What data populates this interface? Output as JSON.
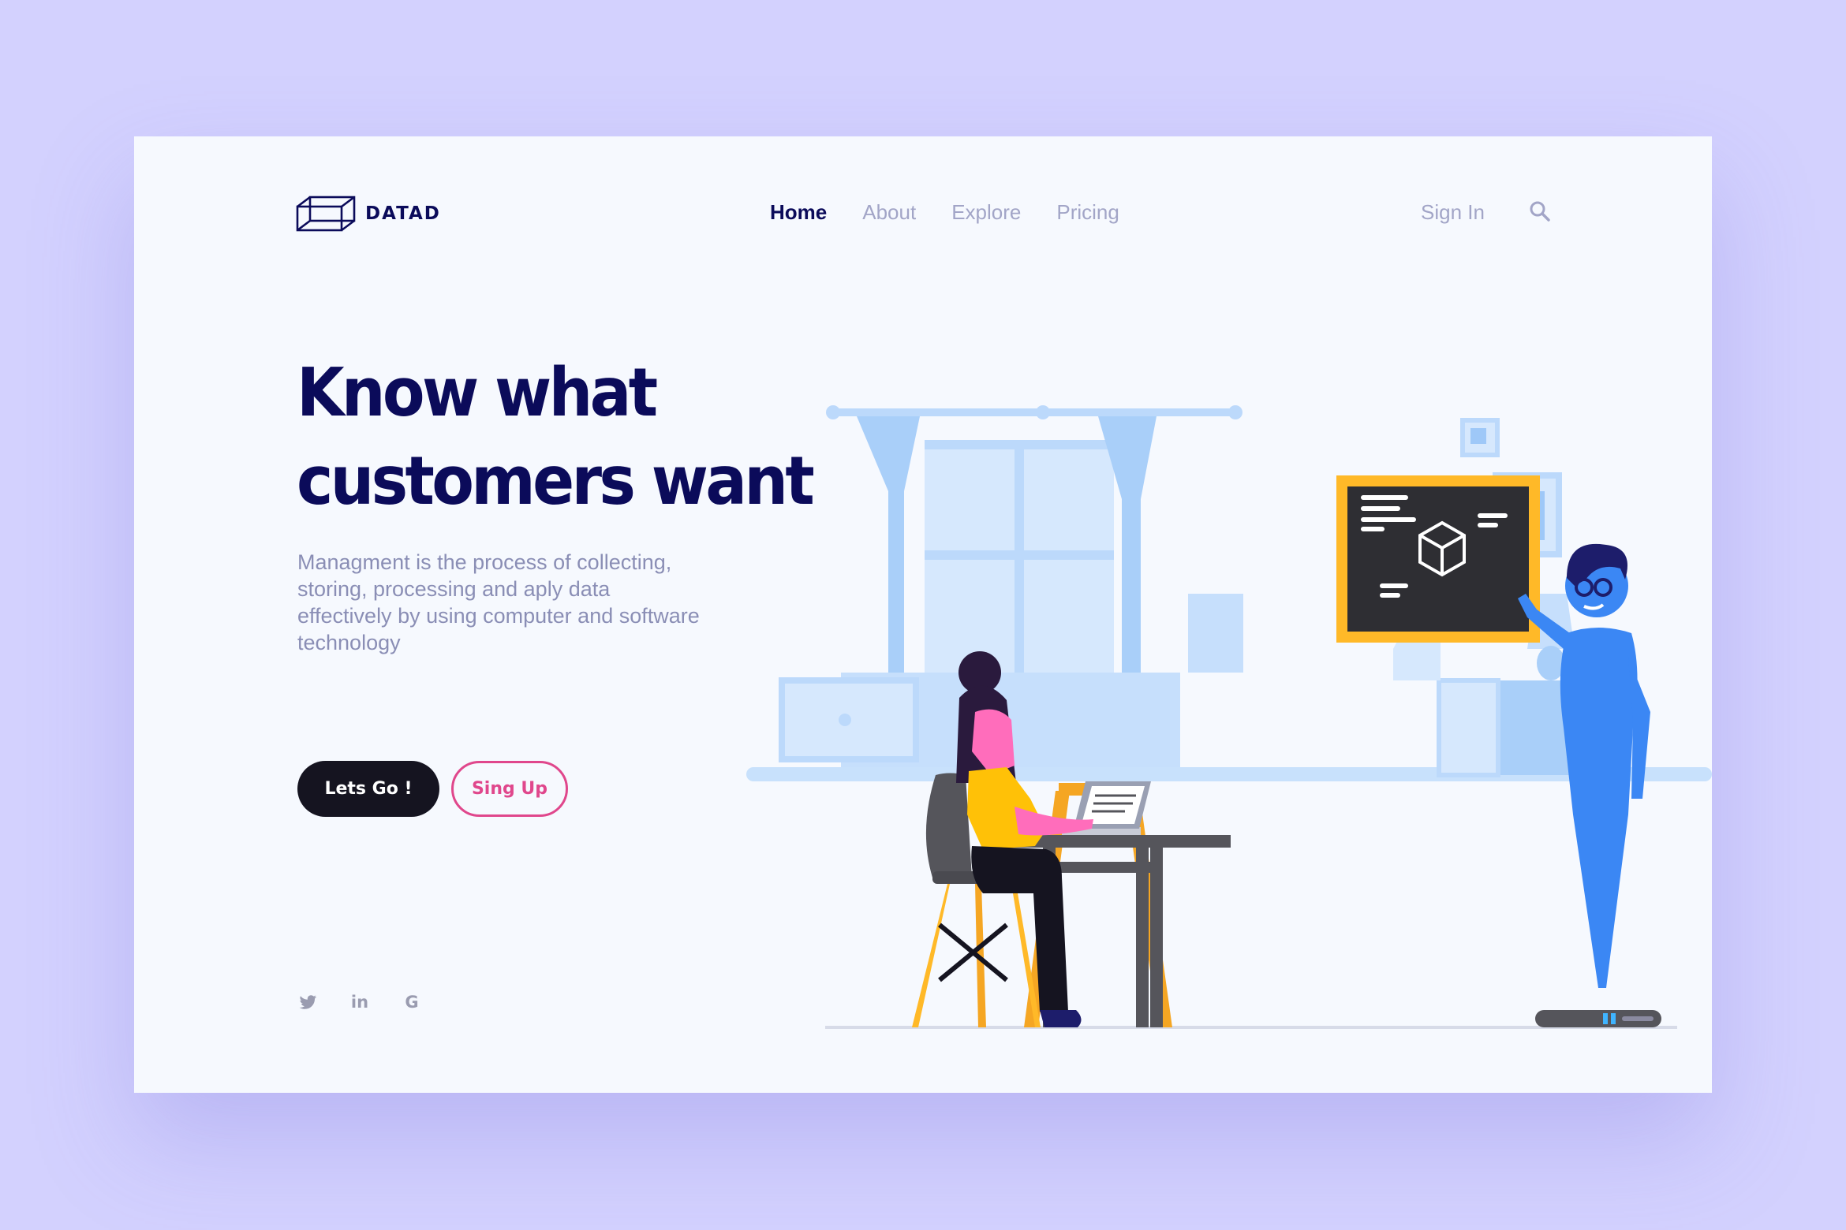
{
  "brand": {
    "name": "DATAD",
    "logo_icon": "wireframe-box-icon",
    "color": "#0b0b5a"
  },
  "nav": {
    "items": [
      {
        "label": "Home",
        "active": true
      },
      {
        "label": "About",
        "active": false
      },
      {
        "label": "Explore",
        "active": false
      },
      {
        "label": "Pricing",
        "active": false
      }
    ],
    "signin_label": "Sign In",
    "search_icon": "search-icon"
  },
  "hero": {
    "headline_line1": "Know what",
    "headline_line2": "customers want",
    "description": "Managment is the process of collecting, storing, processing and aply data effectively by using computer and software technology",
    "primary_button": "Lets Go !",
    "secondary_button": "Sing Up"
  },
  "social": {
    "icons": [
      "twitter-icon",
      "linkedin-icon",
      "google-icon"
    ],
    "linkedin_text": "in",
    "google_text": "G"
  },
  "colors": {
    "background": "#d3d1fe",
    "card": "#f6f9fe",
    "primary_button": "#151420",
    "accent_pink": "#e0478c",
    "nav_inactive": "#a2a5c7"
  }
}
